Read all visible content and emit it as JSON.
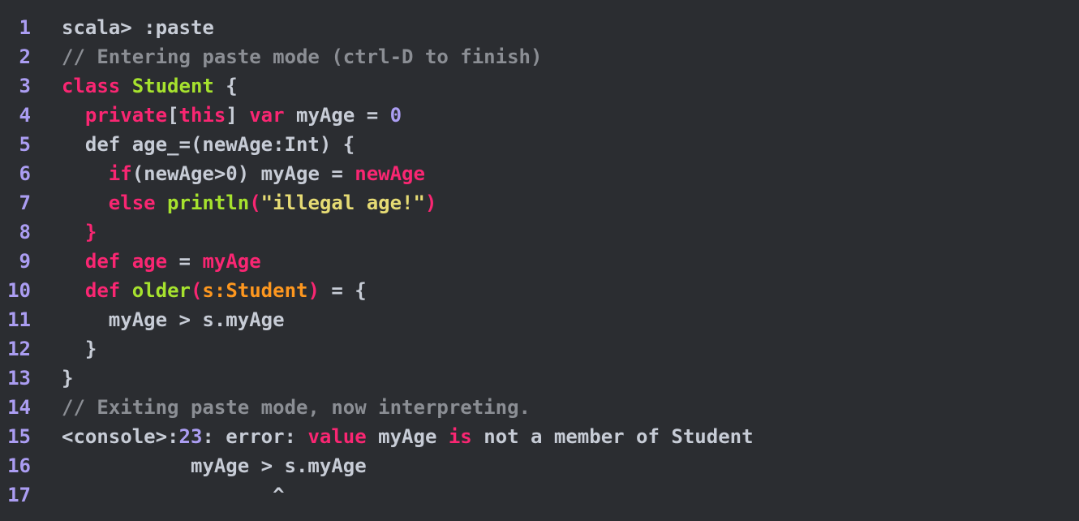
{
  "editor": {
    "lines": [
      {
        "num": "1",
        "tokens": [
          {
            "t": "scala> :paste",
            "c": "plain"
          }
        ]
      },
      {
        "num": "2",
        "tokens": [
          {
            "t": "// Entering paste mode (ctrl-D to finish)",
            "c": "comment"
          }
        ]
      },
      {
        "num": "3",
        "tokens": [
          {
            "t": "class",
            "c": "keyword"
          },
          {
            "t": " ",
            "c": "plain"
          },
          {
            "t": "Student",
            "c": "type"
          },
          {
            "t": " {",
            "c": "plain"
          }
        ]
      },
      {
        "num": "4",
        "tokens": [
          {
            "t": "  ",
            "c": "plain"
          },
          {
            "t": "private",
            "c": "keyword"
          },
          {
            "t": "[",
            "c": "plain"
          },
          {
            "t": "this",
            "c": "keyword"
          },
          {
            "t": "] ",
            "c": "plain"
          },
          {
            "t": "var",
            "c": "keyword"
          },
          {
            "t": " myAge = ",
            "c": "plain"
          },
          {
            "t": "0",
            "c": "number"
          }
        ]
      },
      {
        "num": "5",
        "tokens": [
          {
            "t": "  def age_=(newAge:Int) {",
            "c": "plain"
          }
        ]
      },
      {
        "num": "6",
        "tokens": [
          {
            "t": "    ",
            "c": "plain"
          },
          {
            "t": "if",
            "c": "keyword"
          },
          {
            "t": "(newAge>0) myAge = ",
            "c": "plain"
          },
          {
            "t": "newAge",
            "c": "keyword"
          }
        ]
      },
      {
        "num": "7",
        "tokens": [
          {
            "t": "    ",
            "c": "plain"
          },
          {
            "t": "else",
            "c": "keyword"
          },
          {
            "t": " ",
            "c": "plain"
          },
          {
            "t": "println",
            "c": "type"
          },
          {
            "t": "(",
            "c": "keyword"
          },
          {
            "t": "\"illegal age!\"",
            "c": "string"
          },
          {
            "t": ")",
            "c": "keyword"
          }
        ]
      },
      {
        "num": "8",
        "tokens": [
          {
            "t": "  ",
            "c": "plain"
          },
          {
            "t": "}",
            "c": "keyword"
          }
        ]
      },
      {
        "num": "9",
        "tokens": [
          {
            "t": "  ",
            "c": "plain"
          },
          {
            "t": "def",
            "c": "keyword"
          },
          {
            "t": " ",
            "c": "plain"
          },
          {
            "t": "age",
            "c": "keyword"
          },
          {
            "t": " = ",
            "c": "plain"
          },
          {
            "t": "myAge",
            "c": "keyword"
          }
        ]
      },
      {
        "num": "10",
        "tokens": [
          {
            "t": "  ",
            "c": "plain"
          },
          {
            "t": "def",
            "c": "keyword"
          },
          {
            "t": " ",
            "c": "plain"
          },
          {
            "t": "older",
            "c": "type"
          },
          {
            "t": "(",
            "c": "keyword"
          },
          {
            "t": "s:Student",
            "c": "param"
          },
          {
            "t": ")",
            "c": "keyword"
          },
          {
            "t": " = {",
            "c": "plain"
          }
        ]
      },
      {
        "num": "11",
        "tokens": [
          {
            "t": "    myAge > s.myAge",
            "c": "plain"
          }
        ]
      },
      {
        "num": "12",
        "tokens": [
          {
            "t": "  }",
            "c": "plain"
          }
        ]
      },
      {
        "num": "13",
        "tokens": [
          {
            "t": "}",
            "c": "plain"
          }
        ]
      },
      {
        "num": "14",
        "tokens": [
          {
            "t": "// Exiting paste mode, now interpreting.",
            "c": "comment"
          }
        ]
      },
      {
        "num": "15",
        "tokens": [
          {
            "t": "<console>:",
            "c": "plain"
          },
          {
            "t": "23",
            "c": "number"
          },
          {
            "t": ": error: ",
            "c": "plain"
          },
          {
            "t": "value",
            "c": "keyword"
          },
          {
            "t": " myAge ",
            "c": "plain"
          },
          {
            "t": "is",
            "c": "keyword"
          },
          {
            "t": " not a member of Student",
            "c": "plain"
          }
        ]
      },
      {
        "num": "16",
        "tokens": [
          {
            "t": "           myAge > s.myAge",
            "c": "plain"
          }
        ]
      },
      {
        "num": "17",
        "tokens": [
          {
            "t": "                  ^",
            "c": "plain"
          }
        ]
      }
    ]
  },
  "colors": {
    "background": "#2b2d31",
    "plain": "#c7ccd6",
    "comment": "#8b8e94",
    "keyword": "#f92672",
    "type": "#a6e22e",
    "number": "#ab9df2",
    "string": "#e6db74",
    "param": "#fd971f",
    "line_number": "#ab9df2"
  }
}
